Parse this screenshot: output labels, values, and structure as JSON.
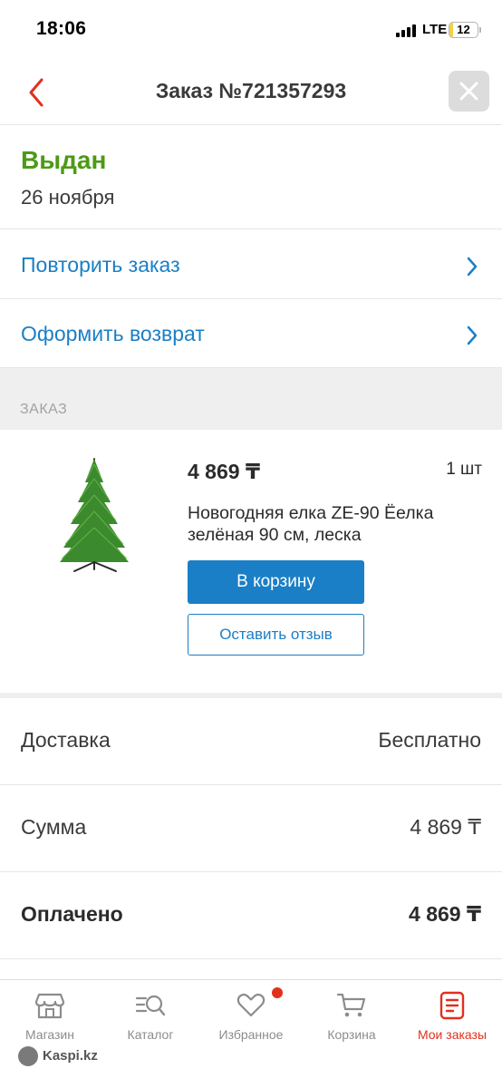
{
  "status_bar": {
    "time": "18:06",
    "network": "LTE",
    "battery_level": "12",
    "battery_fraction": 0.12
  },
  "nav": {
    "title": "Заказ №721357293"
  },
  "order_status": {
    "label": "Выдан",
    "date": "26 ноября"
  },
  "actions": [
    {
      "label": "Повторить заказ"
    },
    {
      "label": "Оформить возврат"
    }
  ],
  "section_header": "ЗАКАЗ",
  "product": {
    "price": "4 869 ₸",
    "quantity": "1 шт",
    "name": "Новогодняя елка ZE-90 Ёелка зелёная 90 см, леска",
    "cart_button": "В корзину",
    "review_button": "Оставить отзыв"
  },
  "summary": [
    {
      "label": "Доставка",
      "value": "Бесплатно"
    },
    {
      "label": "Сумма",
      "value": "4 869 ₸"
    },
    {
      "label": "Оплачено",
      "value": "4 869 ₸"
    }
  ],
  "tabs": [
    {
      "label": "Магазин",
      "icon": "store-icon"
    },
    {
      "label": "Каталог",
      "icon": "catalog-search-icon"
    },
    {
      "label": "Избранное",
      "icon": "heart-icon",
      "has_badge": true
    },
    {
      "label": "Корзина",
      "icon": "cart-icon"
    },
    {
      "label": "Мои заказы",
      "icon": "orders-icon",
      "active": true
    }
  ],
  "watermark": "Kaspi.kz",
  "colors": {
    "accent_blue": "#1a7fc6",
    "status_green": "#4c9a16",
    "active_red": "#e1301d"
  }
}
